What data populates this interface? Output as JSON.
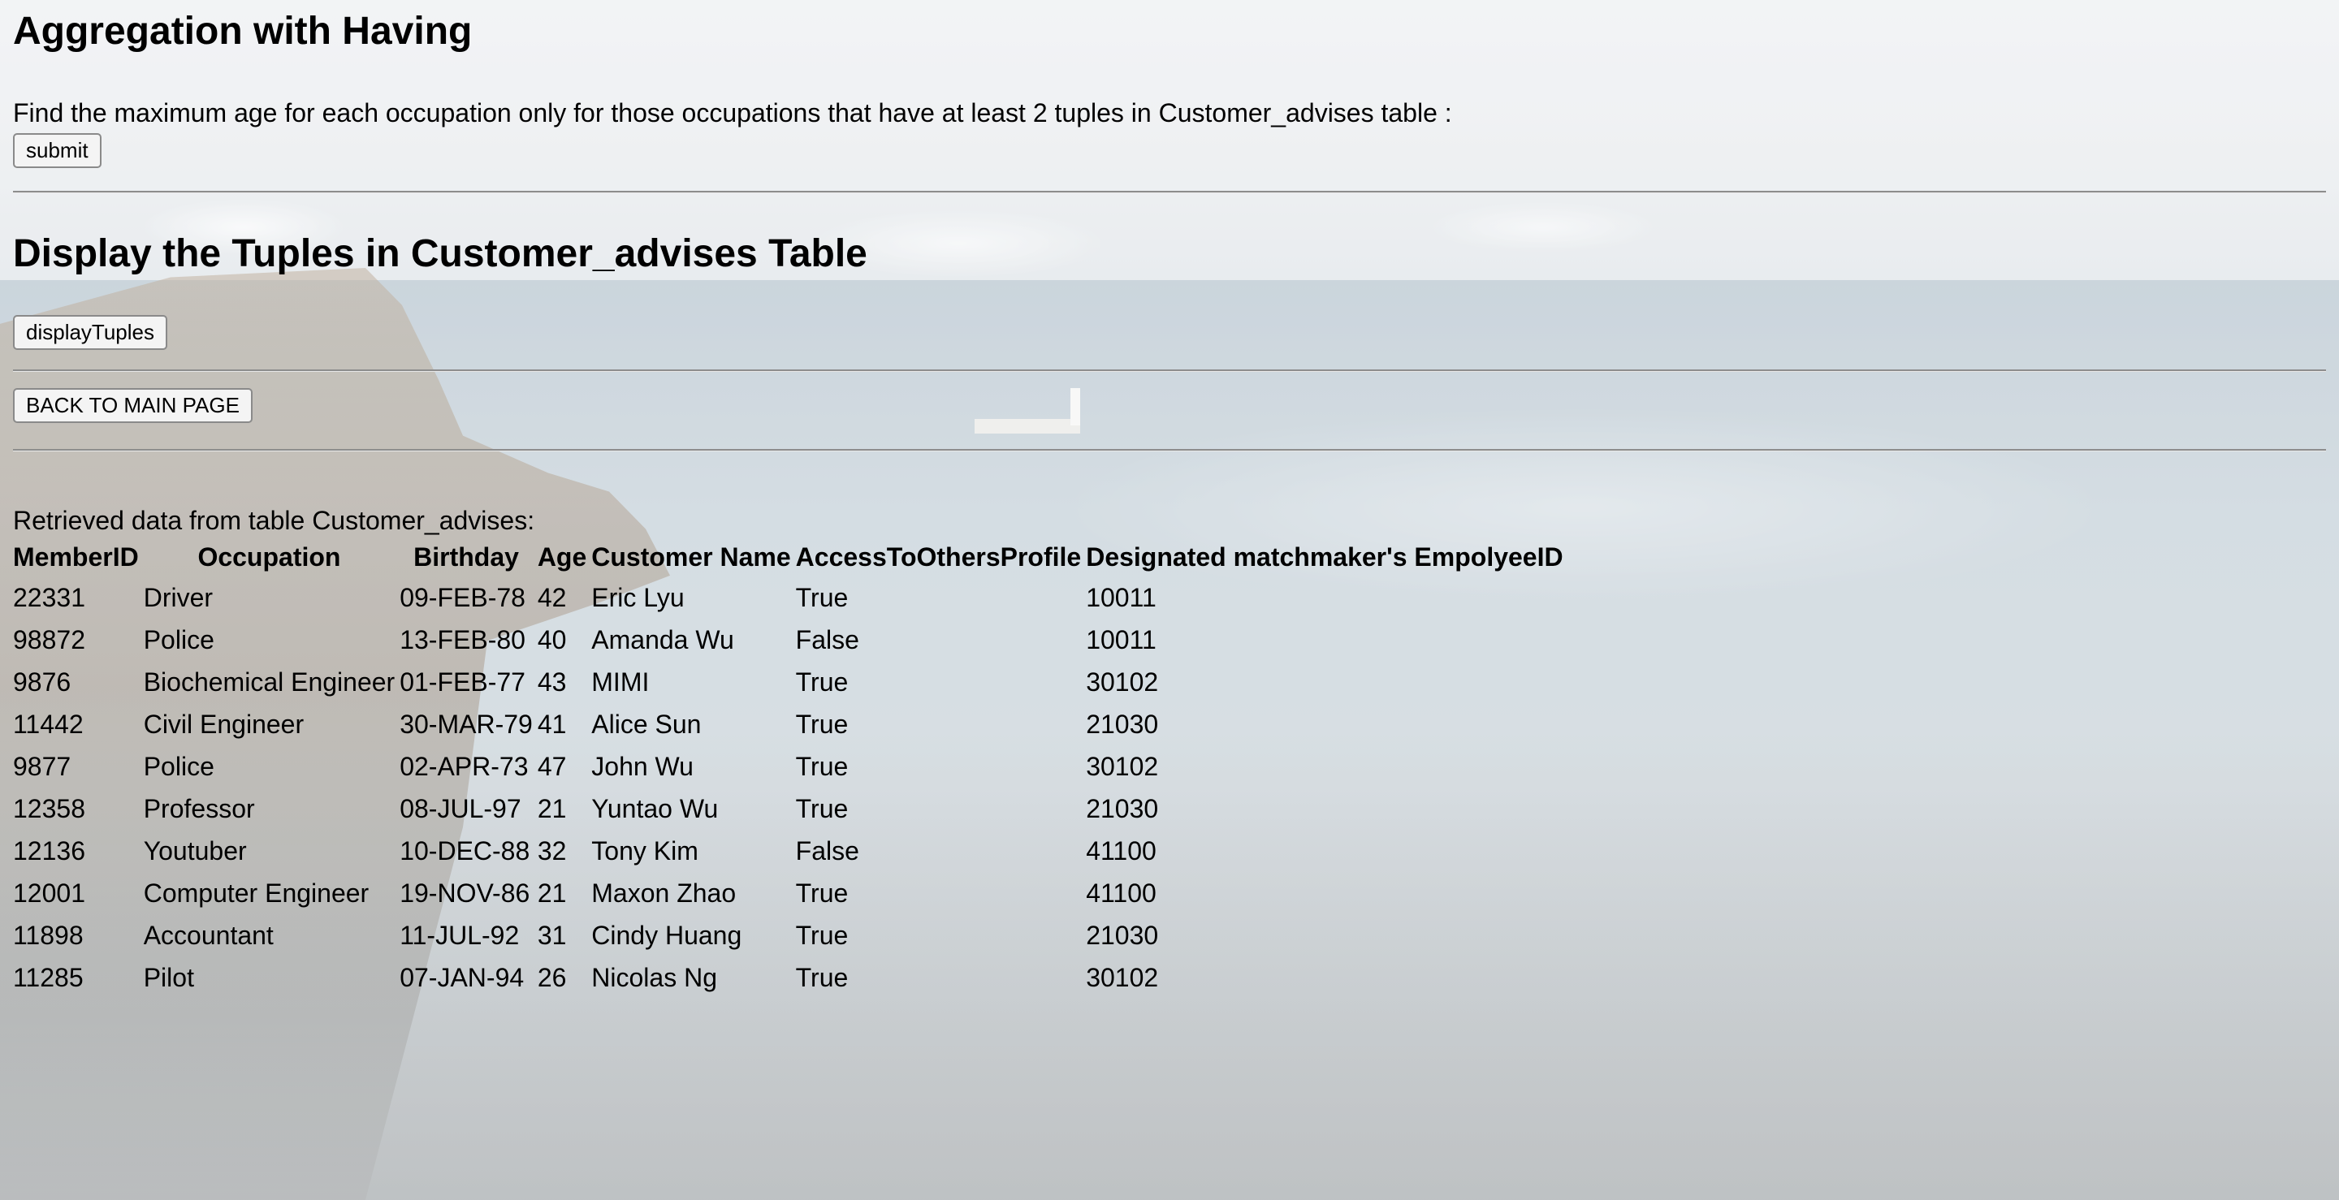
{
  "aggregation": {
    "title": "Aggregation with Having",
    "description": "Find the maximum age for each occupation only for those occupations that have at least 2 tuples in Customer_advises table :",
    "submit_label": "submit"
  },
  "display": {
    "title": "Display the Tuples in Customer_advises Table",
    "button_label": "displayTuples"
  },
  "back_button_label": "BACK TO MAIN PAGE",
  "retrieved_label": "Retrieved data from table Customer_advises:",
  "table": {
    "headers": [
      "MemberID",
      "Occupation",
      "Birthday",
      "Age",
      "Customer Name",
      "AccessToOthersProfile",
      "Designated matchmaker's EmpolyeeID"
    ],
    "rows": [
      [
        "22331",
        "Driver",
        "09-FEB-78",
        "42",
        "Eric Lyu",
        "True",
        "10011"
      ],
      [
        "98872",
        "Police",
        "13-FEB-80",
        "40",
        "Amanda Wu",
        "False",
        "10011"
      ],
      [
        "9876",
        "Biochemical Engineer",
        "01-FEB-77",
        "43",
        "MIMI",
        "True",
        "30102"
      ],
      [
        "11442",
        "Civil Engineer",
        "30-MAR-79",
        "41",
        "Alice Sun",
        "True",
        "21030"
      ],
      [
        "9877",
        "Police",
        "02-APR-73",
        "47",
        "John Wu",
        "True",
        "30102"
      ],
      [
        "12358",
        "Professor",
        "08-JUL-97",
        "21",
        "Yuntao Wu",
        "True",
        "21030"
      ],
      [
        "12136",
        "Youtuber",
        "10-DEC-88",
        "32",
        "Tony Kim",
        "False",
        "41100"
      ],
      [
        "12001",
        "Computer Engineer",
        "19-NOV-86",
        "21",
        "Maxon Zhao",
        "True",
        "41100"
      ],
      [
        "11898",
        "Accountant",
        "11-JUL-92",
        "31",
        "Cindy Huang",
        "True",
        "21030"
      ],
      [
        "11285",
        "Pilot",
        "07-JAN-94",
        "26",
        "Nicolas Ng",
        "True",
        "30102"
      ]
    ]
  },
  "colors": {
    "button_border": "#8a8a8a",
    "button_bg": "#f4f4f4",
    "rule": "#8d8d8d",
    "text": "#000000"
  }
}
